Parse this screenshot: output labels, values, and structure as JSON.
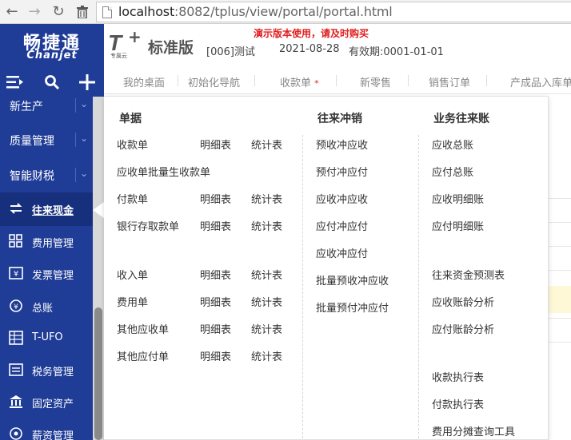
{
  "browser": {
    "url_host": "localhost",
    "url_rest": ":8082/tplus/view/portal/portal.html"
  },
  "header": {
    "brand_cn": "畅捷通",
    "brand_en": "Chanjet",
    "tplus_mark": "T",
    "tplus_plus": "+",
    "tplus_sub": "专属云",
    "edition": "标准版",
    "company": "[006]测试",
    "login_date": "2021-08-28",
    "validity": "有效期:0001-01-01",
    "demo_warning": "演示版本使用，请及时购买"
  },
  "sidebar": {
    "items": [
      {
        "label": "新生产"
      },
      {
        "label": "质量管理"
      },
      {
        "label": "智能财税"
      },
      {
        "label": "往来现金"
      },
      {
        "label": "费用管理"
      },
      {
        "label": "发票管理"
      },
      {
        "label": "总账"
      },
      {
        "label": "T-UFO"
      },
      {
        "label": "税务管理"
      },
      {
        "label": "固定资产"
      },
      {
        "label": "薪资管理"
      }
    ]
  },
  "tabs": [
    {
      "label": "我的桌面"
    },
    {
      "label": "初始化导航"
    },
    {
      "label": "收款单",
      "star": "*"
    },
    {
      "label": "新零售"
    },
    {
      "label": "销售订单"
    },
    {
      "label": "产成品入库单"
    }
  ],
  "panel": {
    "col1": {
      "title": "单据",
      "rows": [
        {
          "main": "收款单",
          "detail": "明细表",
          "stats": "统计表"
        },
        {
          "main": "应收单批量生收款单"
        },
        {
          "main": "付款单",
          "detail": "明细表",
          "stats": "统计表"
        },
        {
          "main": "银行存取款单",
          "detail": "明细表",
          "stats": "统计表"
        },
        {
          "main": "收入单",
          "detail": "明细表",
          "stats": "统计表"
        },
        {
          "main": "费用单",
          "detail": "明细表",
          "stats": "统计表"
        },
        {
          "main": "其他应收单",
          "detail": "明细表",
          "stats": "统计表"
        },
        {
          "main": "其他应付单",
          "detail": "明细表",
          "stats": "统计表"
        }
      ]
    },
    "col2": {
      "title": "往来冲销",
      "items": [
        "预收冲应收",
        "预付冲应付",
        "应收冲应收",
        "应付冲应付",
        "应收冲应付",
        "批量预收冲应收",
        "批量预付冲应付"
      ]
    },
    "col3": {
      "title": "业务往来账",
      "items": [
        "应收总账",
        "应付总账",
        "应收明细账",
        "应付明细账",
        "往来资金预测表",
        "应收账龄分析",
        "应付账龄分析",
        "收款执行表",
        "付款执行表",
        "费用分摊查询工具"
      ]
    }
  }
}
